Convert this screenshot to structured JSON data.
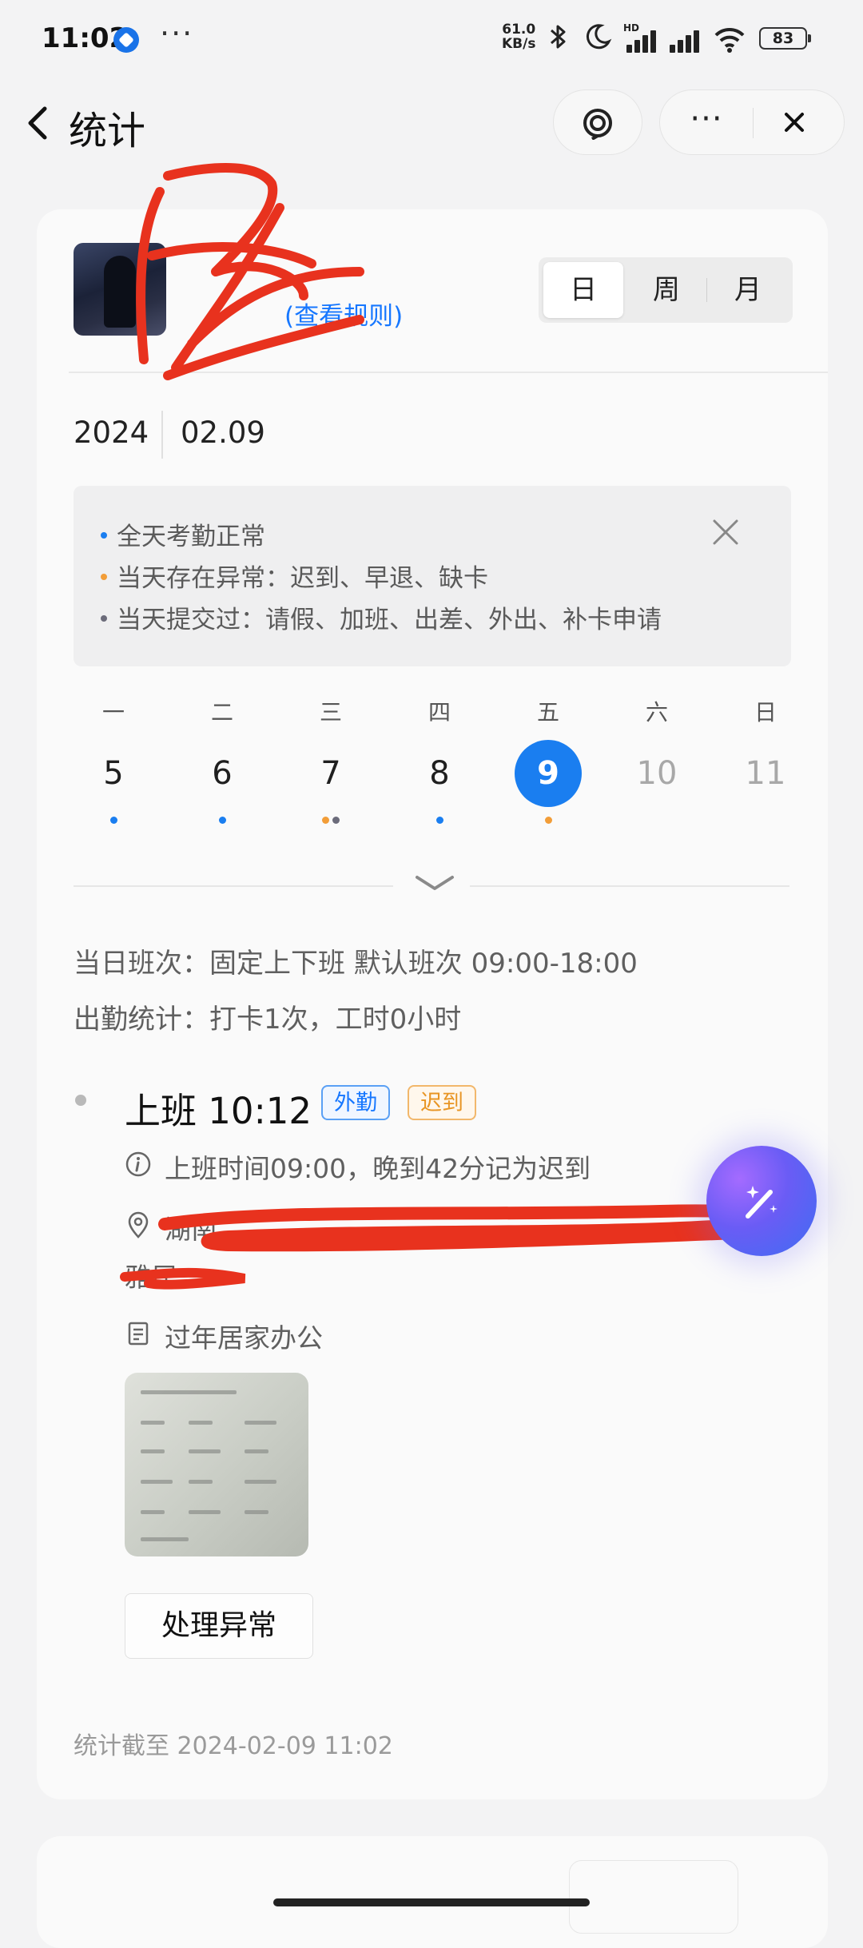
{
  "status_bar": {
    "time": "11:02",
    "net_speed_value": "61.0",
    "net_speed_unit": "KB/s",
    "hd_label": "HD",
    "battery": "83",
    "icons": [
      "app-notification-icon",
      "more-dots-icon",
      "bluetooth-icon",
      "moon-icon",
      "signal-icon",
      "wifi-icon",
      "battery-icon"
    ]
  },
  "nav": {
    "title": "统计",
    "back_icon": "chevron-left-icon",
    "ai_icon": "ai-assistant-icon",
    "more_icon": "more-dots-icon",
    "close_icon": "close-icon"
  },
  "profile": {
    "rule_link": "(查看规则)"
  },
  "view_toggle": {
    "day": "日",
    "week": "周",
    "month": "月",
    "selected": "日"
  },
  "date_header": {
    "year": "2024",
    "date": "02.09"
  },
  "legend": {
    "items": [
      {
        "text": "全天考勤正常",
        "color": "#1a7ef0"
      },
      {
        "text": "当天存在异常：迟到、早退、缺卡",
        "color": "#f29d38"
      },
      {
        "text": "当天提交过：请假、加班、出差、外出、补卡申请",
        "color": "#6b6b7a"
      }
    ]
  },
  "week": {
    "days": [
      {
        "weekday": "一",
        "num": "5",
        "dots": [
          "#1a7ef0"
        ]
      },
      {
        "weekday": "二",
        "num": "6",
        "dots": [
          "#1a7ef0"
        ]
      },
      {
        "weekday": "三",
        "num": "7",
        "dots": [
          "#f29d38",
          "#6b6b7a"
        ]
      },
      {
        "weekday": "四",
        "num": "8",
        "dots": [
          "#1a7ef0"
        ]
      },
      {
        "weekday": "五",
        "num": "9",
        "dots": [
          "#f29d38"
        ],
        "selected": true
      },
      {
        "weekday": "六",
        "num": "10",
        "dots": [],
        "dim": true
      },
      {
        "weekday": "日",
        "num": "11",
        "dots": [],
        "dim": true
      }
    ]
  },
  "shift": {
    "schedule": "当日班次：固定上下班 默认班次 09:00-18:00",
    "summary": "出勤统计：打卡1次，工时0小时"
  },
  "punch": {
    "title": "上班 10:12",
    "tag_outside": "外勤",
    "tag_late": "迟到",
    "late_note": "上班时间09:00，晚到42分记为迟到",
    "address_start": "湖南",
    "address_end": "雅居",
    "memo": "过年居家办公",
    "handle_button": "处理异常"
  },
  "footer": {
    "stats_time": "统计截至 2024-02-09 11:02"
  },
  "colors": {
    "accent": "#1a7ef0",
    "warning": "#f29d38",
    "redaction": "#e8321e"
  }
}
